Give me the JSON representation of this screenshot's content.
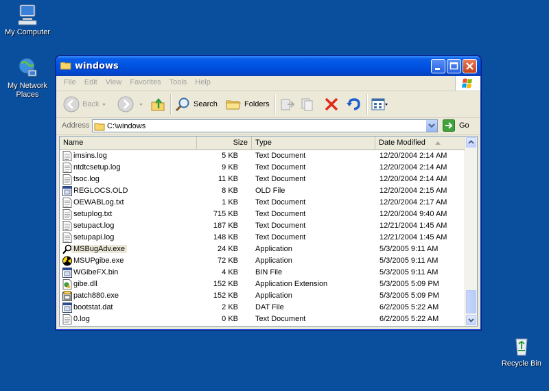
{
  "desktop": {
    "icons": [
      {
        "label": "My Computer"
      },
      {
        "label": "My Network Places"
      },
      {
        "label": "Recycle Bin"
      }
    ]
  },
  "window": {
    "title": "windows",
    "menu": [
      "File",
      "Edit",
      "View",
      "Favorites",
      "Tools",
      "Help"
    ],
    "toolbar": {
      "back_label": "Back",
      "search_label": "Search",
      "folders_label": "Folders"
    },
    "address": {
      "label": "Address",
      "value": "C:\\windows",
      "go_label": "Go"
    },
    "columns": [
      "Name",
      "Size",
      "Type",
      "Date Modified"
    ],
    "files": [
      {
        "name": "imsins.log",
        "size": "5 KB",
        "type": "Text Document",
        "date": "12/20/2004 2:14 AM",
        "icon": "text-file-icon"
      },
      {
        "name": "ntdtcsetup.log",
        "size": "9 KB",
        "type": "Text Document",
        "date": "12/20/2004 2:14 AM",
        "icon": "text-file-icon"
      },
      {
        "name": "tsoc.log",
        "size": "11 KB",
        "type": "Text Document",
        "date": "12/20/2004 2:14 AM",
        "icon": "text-file-icon"
      },
      {
        "name": "REGLOCS.OLD",
        "size": "8 KB",
        "type": "OLD File",
        "date": "12/20/2004 2:15 AM",
        "icon": "generic-file-icon"
      },
      {
        "name": "OEWABLog.txt",
        "size": "1 KB",
        "type": "Text Document",
        "date": "12/20/2004 2:17 AM",
        "icon": "text-file-icon"
      },
      {
        "name": "setuplog.txt",
        "size": "715 KB",
        "type": "Text Document",
        "date": "12/20/2004 9:40 AM",
        "icon": "text-file-icon"
      },
      {
        "name": "setupact.log",
        "size": "187 KB",
        "type": "Text Document",
        "date": "12/21/2004 1:45 AM",
        "icon": "text-file-icon"
      },
      {
        "name": "setupapi.log",
        "size": "148 KB",
        "type": "Text Document",
        "date": "12/21/2004 1:45 AM",
        "icon": "text-file-icon"
      },
      {
        "name": "MSBugAdv.exe",
        "size": "24 KB",
        "type": "Application",
        "date": "5/3/2005 9:11 AM",
        "icon": "magnifier-app-icon"
      },
      {
        "name": "MSUPgibe.exe",
        "size": "72 KB",
        "type": "Application",
        "date": "5/3/2005 9:11 AM",
        "icon": "radiation-app-icon"
      },
      {
        "name": "WGibeFX.bin",
        "size": "4 KB",
        "type": "BIN File",
        "date": "5/3/2005 9:11 AM",
        "icon": "generic-file-icon"
      },
      {
        "name": "gibe.dll",
        "size": "152 KB",
        "type": "Application Extension",
        "date": "5/3/2005 5:09 PM",
        "icon": "dll-file-icon"
      },
      {
        "name": "patch880.exe",
        "size": "152 KB",
        "type": "Application",
        "date": "5/3/2005 5:09 PM",
        "icon": "installer-app-icon"
      },
      {
        "name": "bootstat.dat",
        "size": "2 KB",
        "type": "DAT File",
        "date": "6/2/2005 5:22 AM",
        "icon": "generic-file-icon"
      },
      {
        "name": "0.log",
        "size": "0 KB",
        "type": "Text Document",
        "date": "6/2/2005 5:22 AM",
        "icon": "text-file-icon"
      }
    ]
  }
}
